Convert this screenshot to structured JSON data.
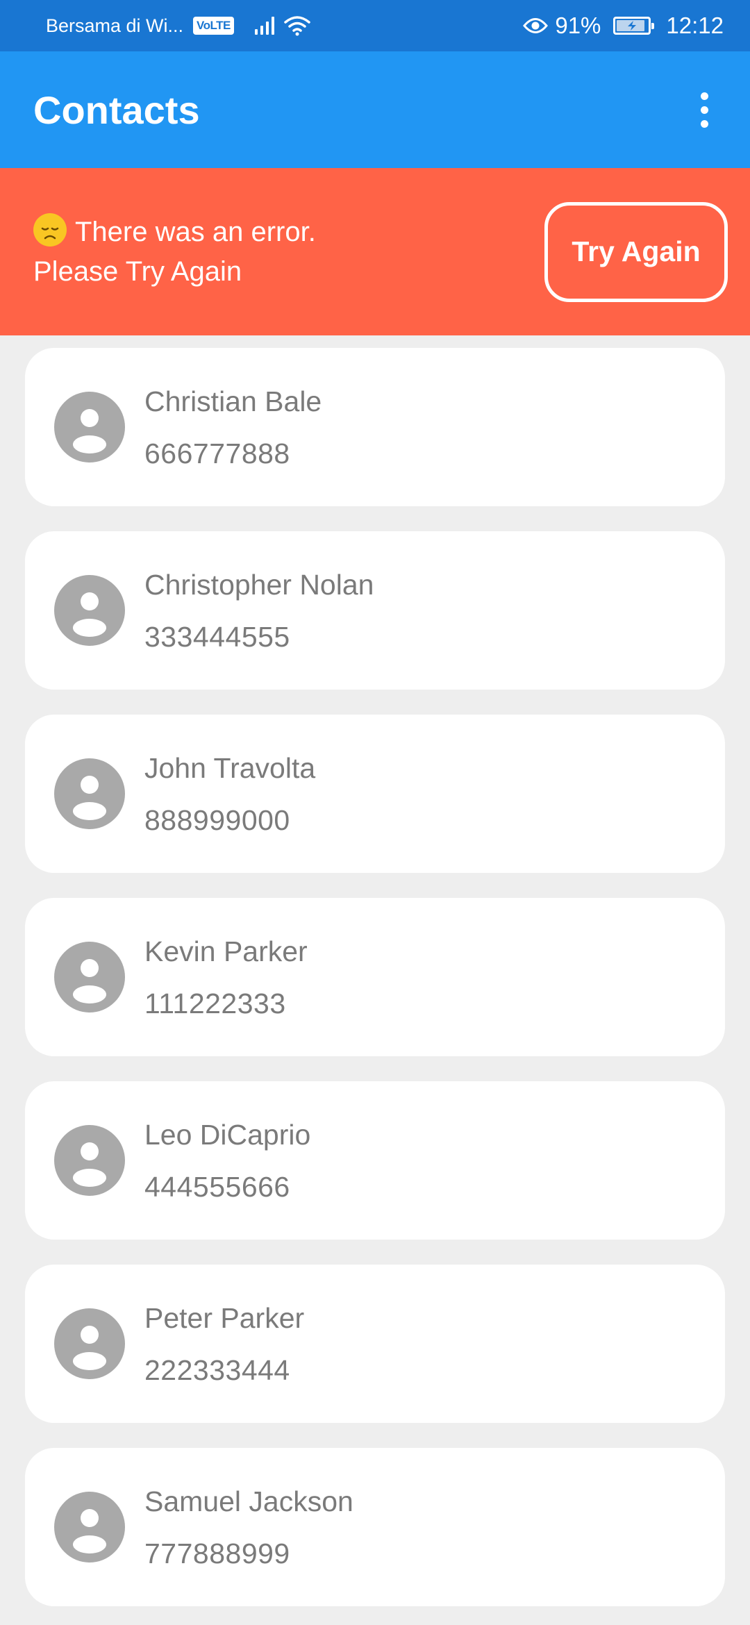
{
  "status_bar": {
    "carrier": "Bersama di Wi...",
    "volte_label": "VoLTE",
    "battery_percent": "91%",
    "battery_level": 0.91,
    "time": "12:12",
    "icons": [
      "signal-icon",
      "wifi-icon",
      "eye-icon",
      "battery-icon"
    ]
  },
  "app_bar": {
    "title": "Contacts",
    "menu_icon": "more-vertical-icon"
  },
  "error_banner": {
    "line1": "There was an error.",
    "line2": "Please Try Again",
    "emoji": "disappointed-face-emoji",
    "button_label": "Try Again"
  },
  "contacts": [
    {
      "name": "Christian Bale",
      "phone": "666777888"
    },
    {
      "name": "Christopher Nolan",
      "phone": "333444555"
    },
    {
      "name": "John Travolta",
      "phone": "888999000"
    },
    {
      "name": "Kevin Parker",
      "phone": "111222333"
    },
    {
      "name": "Leo DiCaprio",
      "phone": "444555666"
    },
    {
      "name": "Peter Parker",
      "phone": "222333444"
    },
    {
      "name": "Samuel Jackson",
      "phone": "777888999"
    }
  ],
  "colors": {
    "status_bar": "#1976d2",
    "app_bar": "#2196f3",
    "error_banner": "#ff6347",
    "background": "#eeeeee",
    "card": "#ffffff",
    "avatar": "#a9a9a9",
    "contact_text": "#7a7a7a"
  }
}
